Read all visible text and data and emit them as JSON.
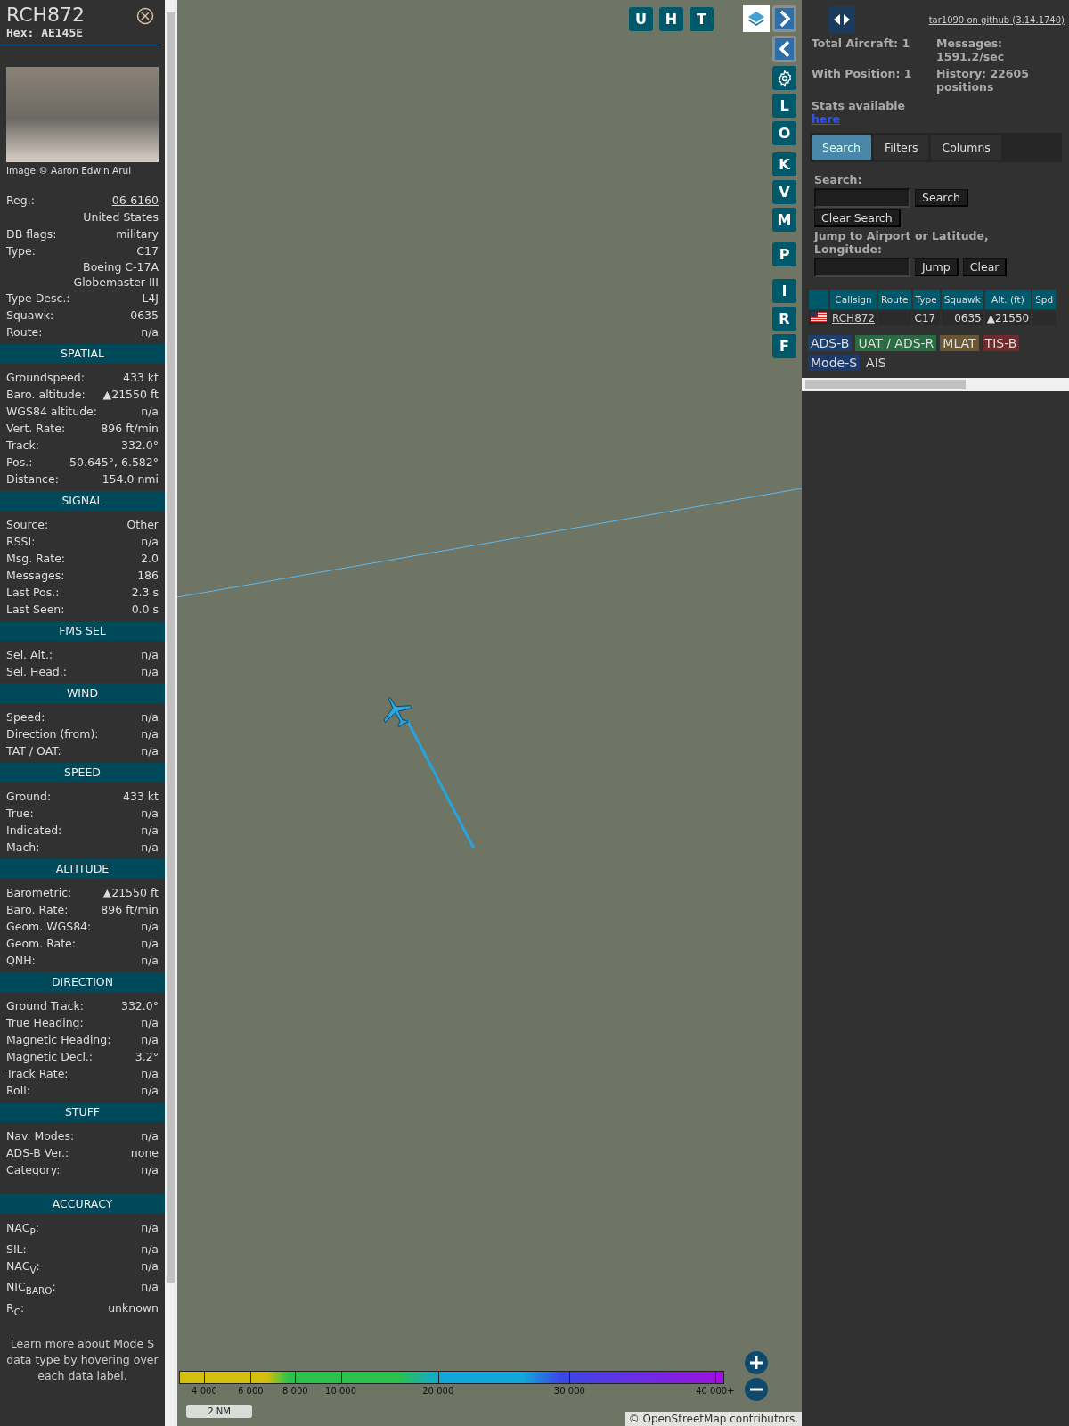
{
  "sidebar": {
    "callsign": "RCH872",
    "hex": "Hex: AE145E",
    "photo_credit": "Image © Aaron Edwin Arul",
    "details": [
      {
        "label": "Reg.:",
        "value": "06-6160",
        "kind": "link"
      },
      {
        "value": "United States",
        "kind": "text"
      },
      {
        "label": "DB flags:",
        "value": "military",
        "kind": "text"
      },
      {
        "label": "Type:",
        "value": "C17",
        "kind": "text"
      },
      {
        "value": "Boeing C-17A Globemaster III",
        "kind": "text"
      },
      {
        "label": "Type Desc.:",
        "value": "L4J",
        "kind": "text"
      },
      {
        "label": "Squawk:",
        "value": "0635",
        "kind": "text"
      },
      {
        "label": "Route:",
        "value": "n/a",
        "kind": "text"
      }
    ],
    "sections": [
      {
        "title": "SPATIAL",
        "rows": [
          {
            "label": "Groundspeed:",
            "value": "433 kt"
          },
          {
            "label": "Baro. altitude:",
            "value": "▲21550 ft"
          },
          {
            "label": "WGS84 altitude:",
            "value": "n/a"
          },
          {
            "label": "Vert. Rate:",
            "value": "896 ft/min"
          },
          {
            "label": "Track:",
            "value": "332.0°"
          },
          {
            "label": "Pos.:",
            "value": "50.645°, 6.582°"
          },
          {
            "label": "Distance:",
            "value": "154.0 nmi"
          }
        ]
      },
      {
        "title": "SIGNAL",
        "rows": [
          {
            "label": "Source:",
            "value": "Other"
          },
          {
            "label": "RSSI:",
            "value": "n/a"
          },
          {
            "label": "Msg. Rate:",
            "value": "2.0"
          },
          {
            "label": "Messages:",
            "value": "186"
          },
          {
            "label": "Last Pos.:",
            "value": "2.3 s"
          },
          {
            "label": "Last Seen:",
            "value": "0.0 s"
          }
        ]
      },
      {
        "title": "FMS SEL",
        "rows": [
          {
            "label": "Sel. Alt.:",
            "value": "n/a"
          },
          {
            "label": "Sel. Head.:",
            "value": "n/a"
          }
        ]
      },
      {
        "title": "WIND",
        "rows": [
          {
            "label": "Speed:",
            "value": "n/a"
          },
          {
            "label": "Direction (from):",
            "value": "n/a"
          },
          {
            "label": "TAT / OAT:",
            "value": "n/a"
          }
        ]
      },
      {
        "title": "SPEED",
        "rows": [
          {
            "label": "Ground:",
            "value": "433 kt"
          },
          {
            "label": "True:",
            "value": "n/a"
          },
          {
            "label": "Indicated:",
            "value": "n/a"
          },
          {
            "label": "Mach:",
            "value": "n/a"
          }
        ]
      },
      {
        "title": "ALTITUDE",
        "rows": [
          {
            "label": "Barometric:",
            "value": "▲21550 ft"
          },
          {
            "label": "Baro. Rate:",
            "value": "896 ft/min"
          },
          {
            "label": "Geom. WGS84:",
            "value": "n/a"
          },
          {
            "label": "Geom. Rate:",
            "value": "n/a"
          },
          {
            "label": "QNH:",
            "value": "n/a"
          }
        ]
      },
      {
        "title": "DIRECTION",
        "rows": [
          {
            "label": "Ground Track:",
            "value": "332.0°"
          },
          {
            "label": "True Heading:",
            "value": "n/a"
          },
          {
            "label": "Magnetic Heading:",
            "value": "n/a"
          },
          {
            "label": "Magnetic Decl.:",
            "value": "3.2°"
          },
          {
            "label": "Track Rate:",
            "value": "n/a"
          },
          {
            "label": "Roll:",
            "value": "n/a"
          }
        ]
      },
      {
        "title": "STUFF",
        "rows": [
          {
            "label": "Nav. Modes:",
            "value": "n/a"
          },
          {
            "label": "ADS-B Ver.:",
            "value": "none"
          },
          {
            "label": "Category:",
            "value": "n/a"
          }
        ]
      },
      {
        "title": "ACCURACY",
        "rows": [
          {
            "label": "NAC$_{P}$:",
            "value": "n/a"
          },
          {
            "label": "SIL:",
            "value": "n/a"
          },
          {
            "label": "NAC$_{V}$:",
            "value": "n/a"
          },
          {
            "label": "NIC$_{BARO}$:",
            "value": "n/a"
          },
          {
            "label": "R$_{C}$:",
            "value": "unknown"
          }
        ]
      }
    ],
    "footer": "Learn more about Mode S data type by hovering over each data label."
  },
  "map": {
    "top_buttons": [
      "U",
      "H",
      "T"
    ],
    "side_buttons": [
      {
        "kind": "arrow-right"
      },
      {
        "kind": "arrow-left"
      },
      {
        "kind": "gear"
      },
      {
        "kind": "letter",
        "label": "L"
      },
      {
        "kind": "letter",
        "label": "O"
      },
      {
        "kind": "letter",
        "label": "K"
      },
      {
        "kind": "letter",
        "label": "V"
      },
      {
        "kind": "letter",
        "label": "M"
      },
      {
        "kind": "letter",
        "label": "P"
      },
      {
        "kind": "letter",
        "label": "I"
      },
      {
        "kind": "letter",
        "label": "R"
      },
      {
        "kind": "letter",
        "label": "F"
      }
    ],
    "altitude_scale": [
      "4 000",
      "6 000",
      "8 000",
      "10 000",
      "20 000",
      "30 000",
      "40 000+"
    ],
    "scale_bar": "2 NM",
    "attribution": "© OpenStreetMap contributors."
  },
  "panel": {
    "github_link": "tar1090 on github (3.14.1740)",
    "stats": [
      {
        "text": "Total Aircraft: 1"
      },
      {
        "text": "Messages: 1591.2/sec"
      },
      {
        "text": "With Position: 1"
      },
      {
        "text": "History: 22605 positions"
      }
    ],
    "stats_note": "Stats available",
    "stats_link": "here",
    "tabs": [
      {
        "label": "Search",
        "selected": true
      },
      {
        "label": "Filters",
        "selected": false
      },
      {
        "label": "Columns",
        "selected": false
      }
    ],
    "search_label": "Search:",
    "search_button": "Search",
    "clear_search_button": "Clear Search",
    "jump_label": "Jump to Airport or Latitude, Longitude:",
    "jump_button": "Jump",
    "clear_button": "Clear",
    "table": {
      "columns": [
        "Callsign",
        "Route",
        "Type",
        "Squawk",
        "Alt. (ft)",
        "Spd"
      ],
      "rows": [
        {
          "callsign": "RCH872",
          "route": "",
          "type": "C17",
          "squawk": "0635",
          "altitude": "▲21550"
        }
      ]
    },
    "legend": [
      {
        "label": "ADS-B",
        "color": "#1d3f6b"
      },
      {
        "label": "UAT / ADS-R",
        "color": "#2a6b42"
      },
      {
        "label": "MLAT",
        "color": "#6a5633"
      },
      {
        "label": "TIS-B",
        "color": "#6e2b2b"
      },
      {
        "label": "Mode-S",
        "color": "#1d3a6b"
      },
      {
        "label": "AIS"
      }
    ]
  }
}
